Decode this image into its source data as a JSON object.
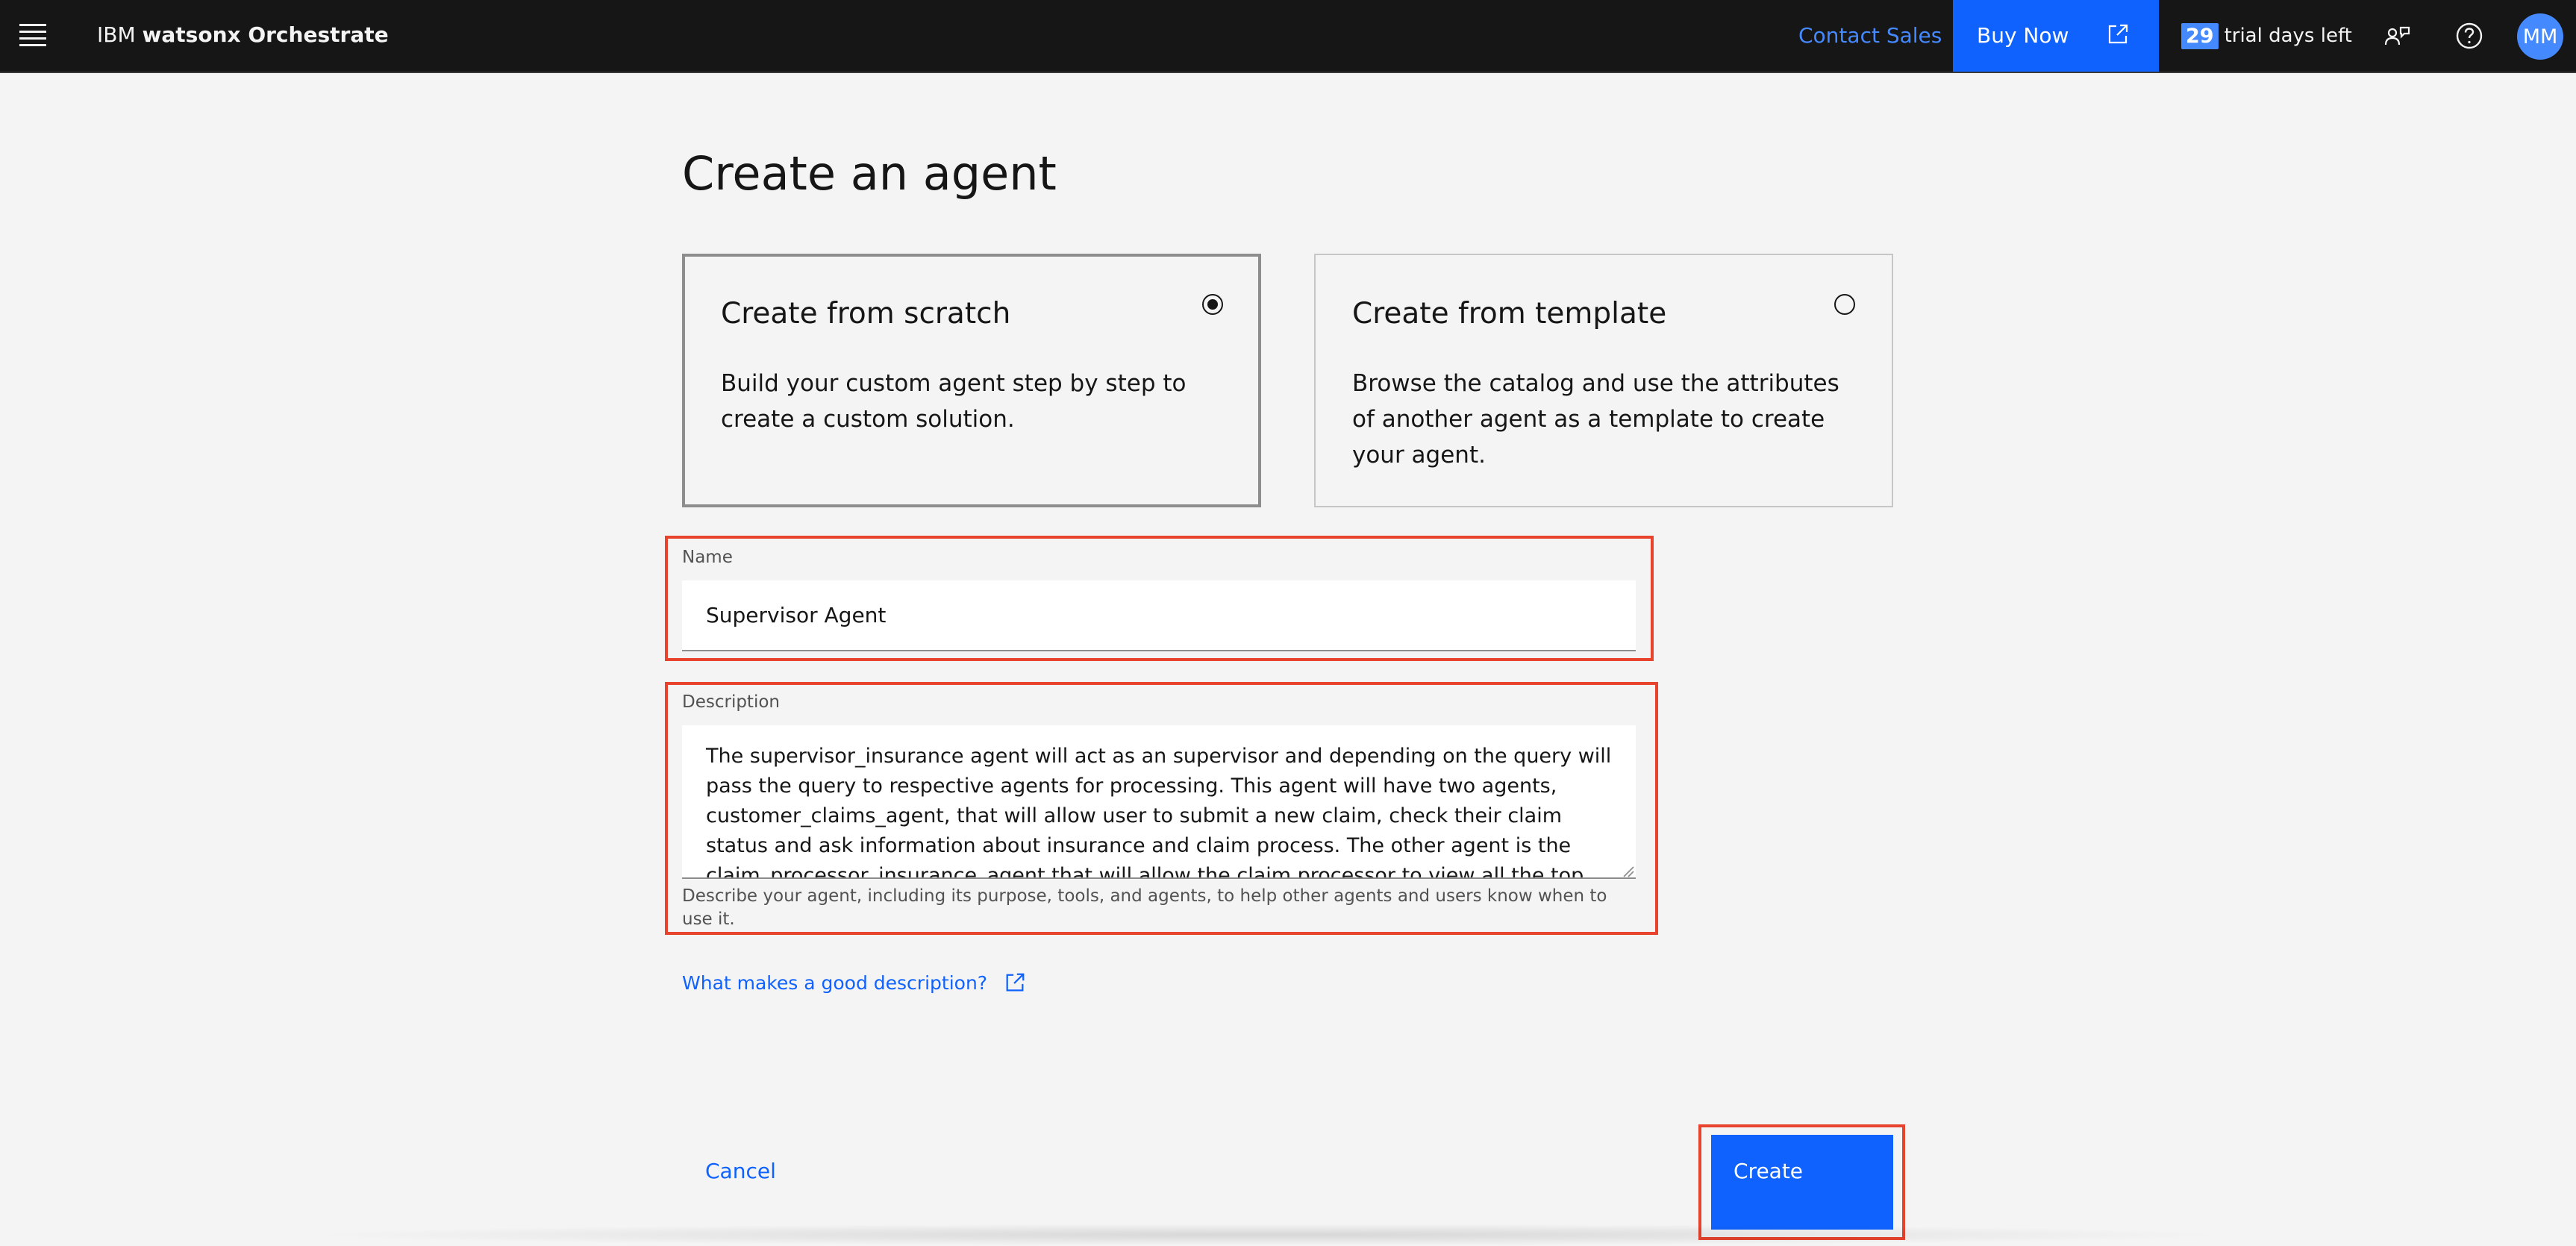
{
  "header": {
    "menu_icon": "hamburger-menu-icon",
    "brand_prefix": "IBM",
    "brand_product": "watsonx Orchestrate",
    "contact_sales": "Contact Sales",
    "buy_now": "Buy Now",
    "buy_now_icon": "launch-icon",
    "trial_days": "29",
    "trial_text": "trial days left",
    "agent_switch_icon": "user-switch-icon",
    "help_icon": "help-icon",
    "avatar_initials": "MM"
  },
  "page": {
    "title": "Create an agent"
  },
  "options": [
    {
      "title": "Create from scratch",
      "description": "Build your custom agent step by step to create a custom solution.",
      "selected": true
    },
    {
      "title": "Create from template",
      "description": "Browse the catalog and use the attributes of another agent as a template to create your agent.",
      "selected": false
    }
  ],
  "form": {
    "name_label": "Name",
    "name_value": "Supervisor Agent",
    "description_label": "Description",
    "description_value": "The supervisor_insurance agent will act as an supervisor and depending on the query will pass the query to respective agents for processing. This agent will have two agents, customer_claims_agent, that will allow user to submit a new claim, check their claim status and ask information about insurance and claim process. The other agent is the claim_processor_insurance_agent that will allow the claim processor to view all the top open",
    "description_helper": "Describe your agent, including its purpose, tools, and agents, to help other agents and users know when to use it.",
    "help_link": "What makes a good description?",
    "help_link_icon": "launch-icon"
  },
  "actions": {
    "cancel": "Cancel",
    "create": "Create"
  },
  "colors": {
    "header_bg": "#161616",
    "page_bg": "#f4f4f4",
    "primary": "#0f62fe",
    "link": "#4589ff",
    "highlight": "#e8432d"
  }
}
